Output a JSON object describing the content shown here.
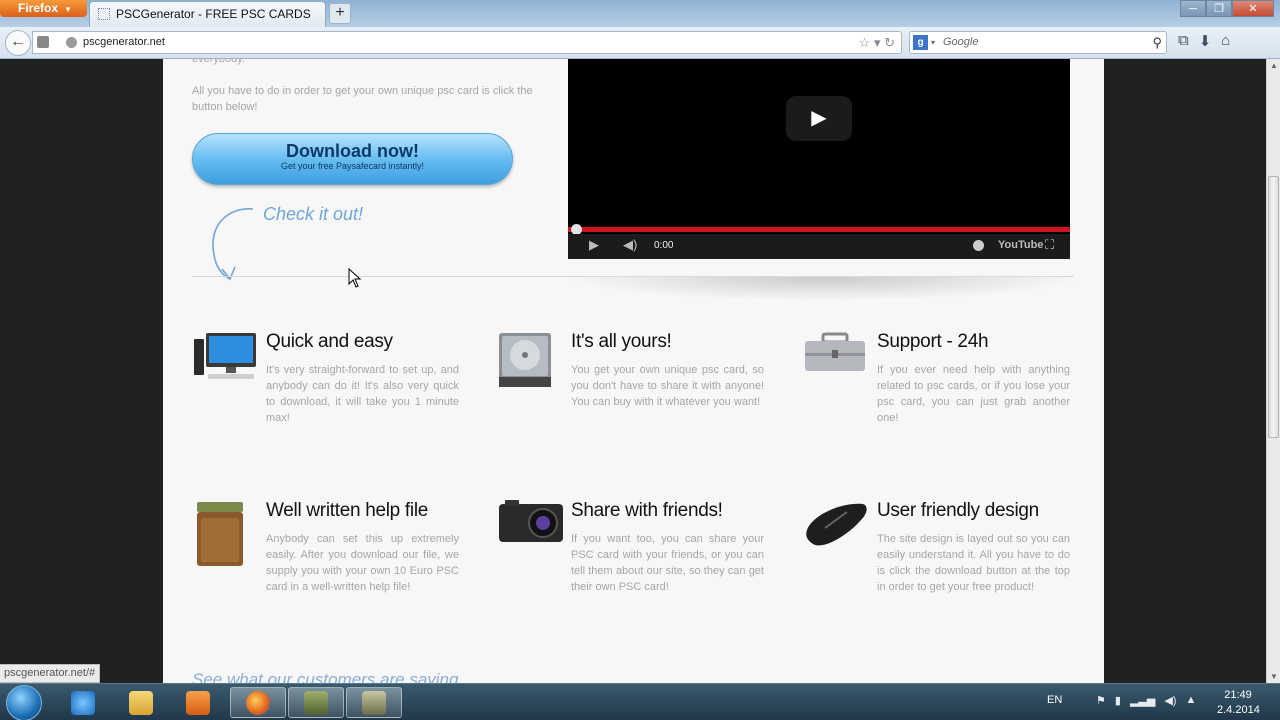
{
  "browser": {
    "menu_label": "Firefox",
    "tab_title": "PSCGenerator - FREE PSC CARDS",
    "new_tab": "+",
    "url": "pscgenerator.net",
    "search_placeholder": "Google",
    "search_engine_icon": "google-icon",
    "status_link": "pscgenerator.net/#"
  },
  "page": {
    "intro_partial": "everybody.",
    "intro": "All you have to do in order to get your own unique psc card is click the button below!",
    "download_title": "Download now!",
    "download_subtitle": "Get your free Paysafecard instantly!",
    "check_it_out": "Check it out!",
    "video": {
      "time": "0:00",
      "brand": "YouTube",
      "progress": 0
    },
    "features": [
      {
        "title": "Quick and easy",
        "icon": "computer-icon",
        "text": "It's very straight-forward to set up, and anybody can do it! It's also very quick to download, it will take you 1 minute max!"
      },
      {
        "title": "It's all yours!",
        "icon": "hard-drive-icon",
        "text": "You get your own unique psc card, so you don't have to share it with anyone! You can buy with it whatever you want!"
      },
      {
        "title": "Support - 24h",
        "icon": "toolbox-icon",
        "text": "If you ever need help with anything related to psc cards, or if you lose your psc card, you can just grab another one!"
      },
      {
        "title": "Well written help file",
        "icon": "books-icon",
        "text": "Anybody can set this up extremely easily. After you download our file, we supply you with your own 10 Euro PSC card in a well-written help file!"
      },
      {
        "title": "Share with friends!",
        "icon": "camera-icon",
        "text": "If you want too, you can share your PSC card with your friends, or you can tell them about our site, so they can get their own PSC card!"
      },
      {
        "title": "User friendly design",
        "icon": "mouse-icon",
        "text": "The site design is layed out so you can easily understand it. All you have to do is click the download button at the top in order to get your free product!"
      }
    ],
    "testimonial_heading": "See what our customers are saying"
  },
  "taskbar": {
    "language": "EN",
    "time": "21:49",
    "date": "2.4.2014"
  },
  "colors": {
    "accent_button": "#62baf0",
    "video_progress": "#d1151c",
    "feature_text": "#a6a6a6"
  }
}
